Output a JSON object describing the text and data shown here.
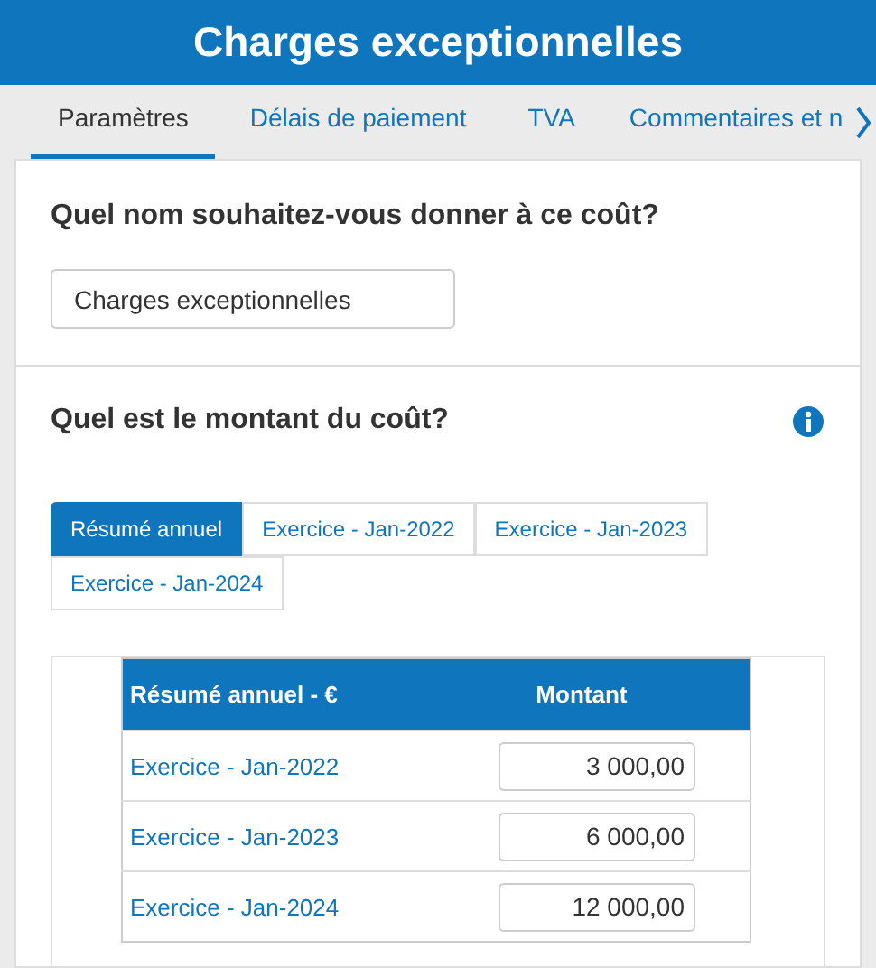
{
  "header": {
    "title": "Charges exceptionnelles"
  },
  "tabs": [
    {
      "label": "Paramètres",
      "selected": true
    },
    {
      "label": "Délais de paiement",
      "selected": false
    },
    {
      "label": "TVA",
      "selected": false
    },
    {
      "label": "Commentaires et n",
      "selected": false
    }
  ],
  "name_section": {
    "question": "Quel nom souhaitez-vous donner à ce coût?",
    "value": "Charges exceptionnelles"
  },
  "amount_section": {
    "question": "Quel est le montant du coût?",
    "subtabs": [
      {
        "label": "Résumé annuel",
        "selected": true
      },
      {
        "label": "Exercice - Jan-2022",
        "selected": false
      },
      {
        "label": "Exercice - Jan-2023",
        "selected": false
      },
      {
        "label": "Exercice - Jan-2024",
        "selected": false
      }
    ],
    "table": {
      "columns": [
        "Résumé annuel - €",
        "Montant"
      ],
      "rows": [
        {
          "period": "Exercice - Jan-2022",
          "amount": "3 000,00"
        },
        {
          "period": "Exercice - Jan-2023",
          "amount": "6 000,00"
        },
        {
          "period": "Exercice - Jan-2024",
          "amount": "12 000,00"
        }
      ]
    }
  }
}
